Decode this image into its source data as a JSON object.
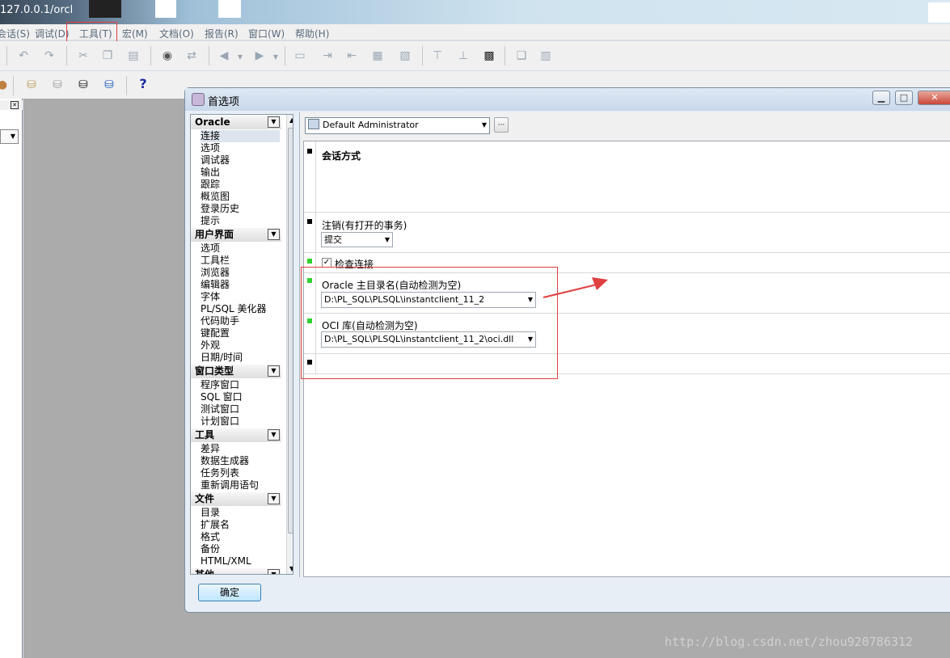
{
  "window": {
    "title": "127.0.0.1/orcl"
  },
  "menubar": {
    "items": [
      "会话(S)",
      "调试(D)",
      "工具(T)",
      "宏(M)",
      "文档(O)",
      "报告(R)",
      "窗口(W)",
      "帮助(H)"
    ]
  },
  "toolbar2": {
    "help_label": "?"
  },
  "dialog": {
    "title": "首选项",
    "buttons": {
      "min": "▁",
      "max": "□",
      "close": "✕"
    },
    "ok_label": "确定",
    "profile": {
      "value": "Default Administrator",
      "more": "···"
    }
  },
  "tree": {
    "groups": [
      {
        "label": "Oracle",
        "items": [
          "连接",
          "选项",
          "调试器",
          "输出",
          "跟踪",
          "概览图",
          "登录历史",
          "提示"
        ]
      },
      {
        "label": "用户界面",
        "items": [
          "选项",
          "工具栏",
          "浏览器",
          "编辑器",
          "字体",
          "PL/SQL 美化器",
          "代码助手",
          "键配置",
          "外观",
          "日期/时间"
        ]
      },
      {
        "label": "窗口类型",
        "items": [
          "程序窗口",
          "SQL 窗口",
          "测试窗口",
          "计划窗口"
        ]
      },
      {
        "label": "工具",
        "items": [
          "差异",
          "数据生成器",
          "任务列表",
          "重新调用语句"
        ]
      },
      {
        "label": "文件",
        "items": [
          "目录",
          "扩展名",
          "格式",
          "备份",
          "HTML/XML"
        ]
      },
      {
        "label": "其他",
        "items": []
      }
    ]
  },
  "settings": {
    "session_mode_label": "会话方式",
    "logoff_label": "注销(有打开的事务)",
    "logoff_value": "提交",
    "check_connection_label": "检查连接",
    "oracle_home_label": "Oracle 主目录名(自动检测为空)",
    "oracle_home_value": "D:\\PL_SQL\\PLSQL\\instantclient_11_2",
    "oci_label": "OCI 库(自动检测为空)",
    "oci_value": "D:\\PL_SQL\\PLSQL\\instantclient_11_2\\oci.dll"
  },
  "watermark": "http://blog.csdn.net/zhou920786312",
  "colors": {
    "annotation_red": "#e04040",
    "accent_green": "#30d030"
  }
}
